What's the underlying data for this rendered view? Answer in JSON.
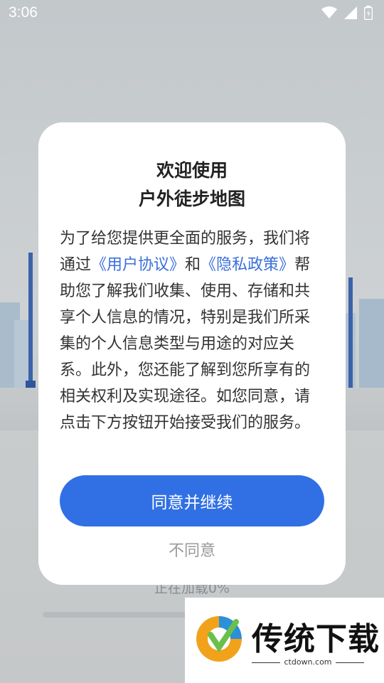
{
  "status_bar": {
    "time": "3:06",
    "icons": [
      "wifi-icon",
      "signal-icon",
      "battery-icon"
    ]
  },
  "background": {
    "loading_text": "正在加载0%",
    "progress": 0
  },
  "dialog": {
    "title_line1": "欢迎使用",
    "title_line2": "户外徒步地图",
    "body": {
      "part1": "为了给您提供更全面的服务，我们将通过",
      "link_user_agreement": "《用户协议》",
      "part2": "和",
      "link_privacy": "《隐私政策》",
      "part3": "帮助您了解我们收集、使用、存储和共享个人信息的情况，特别是我们所采集的个人信息类型与用途的对应关系。此外，您还能了解到您所享有的相关权利及实现途径。如您同意，请点击下方按钮开始接受我们的服务。"
    },
    "agree_button": "同意并继续",
    "disagree_button": "不同意"
  },
  "watermark": {
    "title": "传统下载",
    "url": "ctdown.com"
  },
  "colors": {
    "accent": "#3170e4",
    "link": "#3a6fdb"
  }
}
